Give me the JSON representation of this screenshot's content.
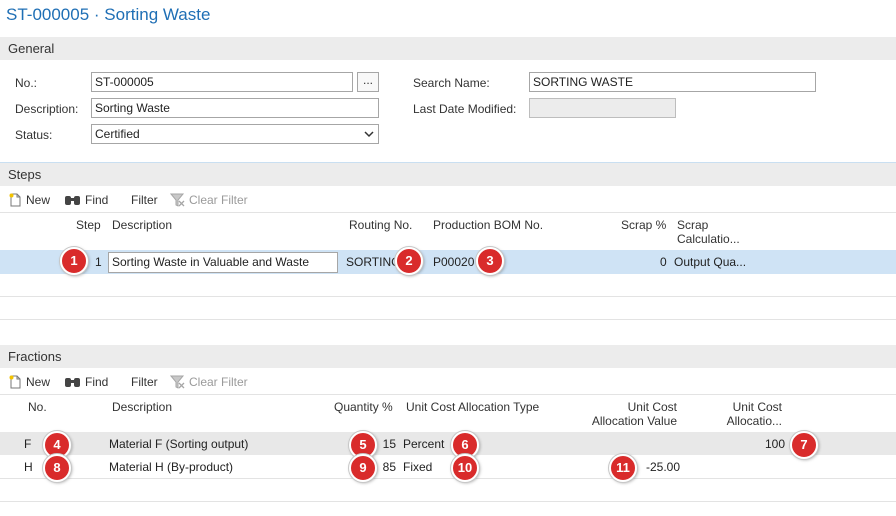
{
  "page": {
    "title": "ST-000005 · Sorting Waste"
  },
  "general": {
    "section_title": "General",
    "no_label": "No.:",
    "no_value": "ST-000005",
    "assist_label": "...",
    "description_label": "Description:",
    "description_value": "Sorting Waste",
    "status_label": "Status:",
    "status_value": "Certified",
    "search_name_label": "Search Name:",
    "search_name_value": "SORTING WASTE",
    "last_modified_label": "Last Date Modified:",
    "last_modified_value": ""
  },
  "steps": {
    "section_title": "Steps",
    "toolbar": {
      "new": "New",
      "find": "Find",
      "filter": "Filter",
      "clear_filter": "Clear Filter"
    },
    "columns": {
      "step": "Step",
      "description": "Description",
      "routing_no": "Routing No.",
      "production_bom_no": "Production BOM No.",
      "scrap_pct": "Scrap %",
      "scrap_calc_1": "Scrap",
      "scrap_calc_2": "Calculatio..."
    },
    "rows": [
      {
        "step": "1",
        "description": "Sorting Waste in Valuable and Waste",
        "routing_no": "SORTING",
        "production_bom_no": "P00020",
        "scrap_pct": "0",
        "scrap_calc": "Output Qua..."
      }
    ]
  },
  "fractions": {
    "section_title": "Fractions",
    "toolbar": {
      "new": "New",
      "find": "Find",
      "filter": "Filter",
      "clear_filter": "Clear Filter"
    },
    "columns": {
      "no": "No.",
      "description": "Description",
      "quantity_pct": "Quantity %",
      "alloc_type": "Unit Cost Allocation Type",
      "alloc_value_1": "Unit Cost",
      "alloc_value_2": "Allocation Value",
      "alloc_pct_1": "Unit Cost",
      "alloc_pct_2": "Allocatio..."
    },
    "rows": [
      {
        "no": "F",
        "description": "Material F (Sorting output)",
        "quantity_pct": "15",
        "alloc_type": "Percent",
        "alloc_value": "",
        "alloc_pct": "100"
      },
      {
        "no": "H",
        "description": "Material H (By-product)",
        "quantity_pct": "85",
        "alloc_type": "Fixed",
        "alloc_value": "-25.00",
        "alloc_pct": ""
      }
    ]
  },
  "badges": [
    "1",
    "2",
    "3",
    "4",
    "5",
    "6",
    "7",
    "8",
    "9",
    "10",
    "11"
  ],
  "colors": {
    "accent": "#1f6fb5",
    "selected_row": "#cfe3f5",
    "badge": "#d92b2b"
  }
}
